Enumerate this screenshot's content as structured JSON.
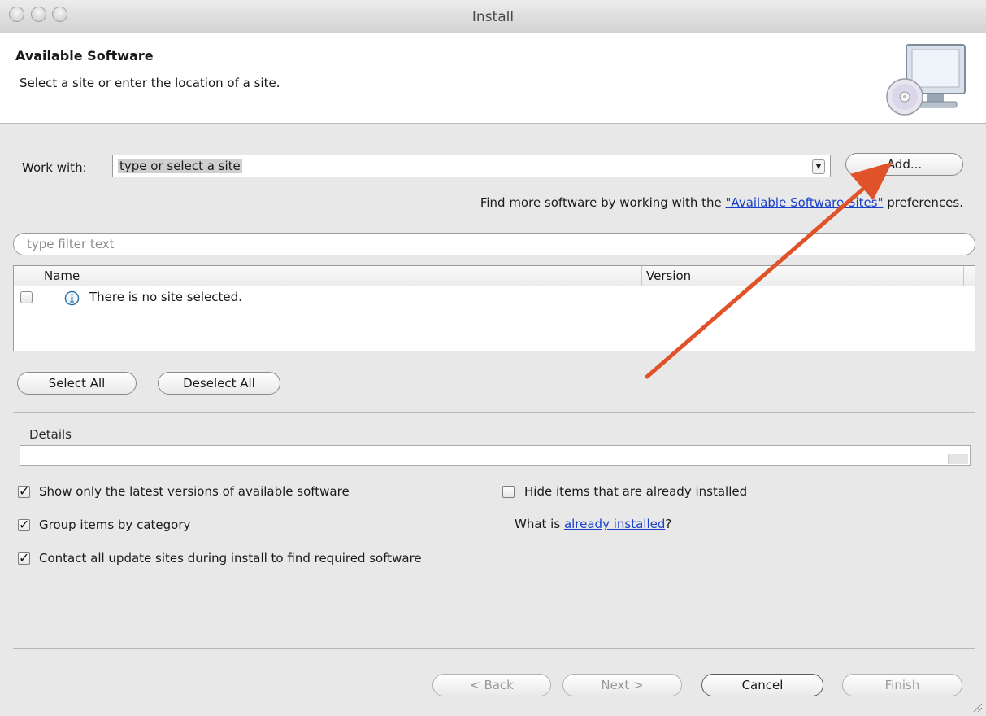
{
  "window": {
    "title": "Install"
  },
  "banner": {
    "title": "Available Software",
    "subtitle": "Select a site or enter the location of a site.",
    "icon": "computer-cd-icon"
  },
  "work_with": {
    "label": "Work with:",
    "value": "type or select a site",
    "add_button": "Add..."
  },
  "find_more": {
    "prefix": "Find more software by working with the ",
    "link": "\"Available Software Sites\"",
    "suffix": " preferences."
  },
  "filter": {
    "placeholder": "type filter text"
  },
  "table": {
    "columns": [
      "Name",
      "Version"
    ],
    "rows": [
      {
        "name": "There is no site selected.",
        "version": ""
      }
    ]
  },
  "selection_buttons": {
    "select_all": "Select All",
    "deselect_all": "Deselect All"
  },
  "details": {
    "label": "Details"
  },
  "options": {
    "show_latest": {
      "label": "Show only the latest versions of available software",
      "checked": true
    },
    "group_by_category": {
      "label": "Group items by category",
      "checked": true
    },
    "contact_sites": {
      "label": "Contact all update sites during install to find required software",
      "checked": true
    },
    "hide_installed": {
      "label": "Hide items that are already installed",
      "checked": false
    },
    "what_is": {
      "prefix": "What is ",
      "link": "already installed",
      "suffix": "?"
    }
  },
  "footer": {
    "back": "< Back",
    "next": "Next >",
    "cancel": "Cancel",
    "finish": "Finish"
  },
  "colors": {
    "annotation_arrow": "#e0522a",
    "link": "#1a40c8"
  }
}
